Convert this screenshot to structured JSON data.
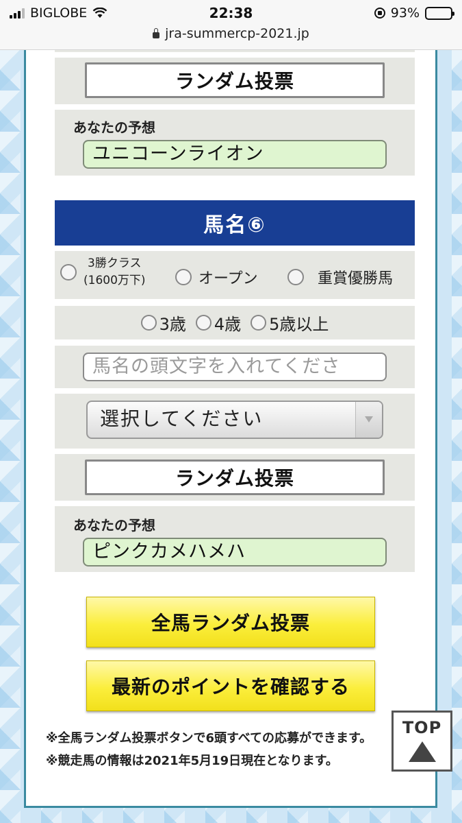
{
  "status_bar": {
    "carrier": "BIGLOBE",
    "time": "22:38",
    "battery": "93%",
    "battery_level": 0.93,
    "url": "jra-summercp-2021.jp"
  },
  "prev_entry": {
    "random_label": "ランダム投票",
    "guess_label": "あなたの予想",
    "guess_value": "ユニコーンライオン"
  },
  "horse6": {
    "title": "馬名⑥",
    "class_options": [
      {
        "line1": "3勝クラス",
        "line2": "(1600万下)"
      },
      {
        "label": "オープン"
      },
      {
        "label": "重賞優勝馬"
      }
    ],
    "age_options": [
      "3歳",
      "4歳",
      "5歳以上"
    ],
    "search_placeholder": "馬名の頭文字を入れてくださ",
    "select_value": "選択してください",
    "random_label": "ランダム投票",
    "guess_label": "あなたの予想",
    "guess_value": "ピンクカメハメハ"
  },
  "buttons": {
    "all_random": "全馬ランダム投票",
    "check_points": "最新のポイントを確認する"
  },
  "notes": [
    "※全馬ランダム投票ボタンで6頭すべての応募ができます。",
    "※競走馬の情報は2021年5月19日現在となります。"
  ],
  "top_button": "TOP",
  "colors": {
    "header_blue": "#183e94",
    "guess_green": "#dff5d0",
    "button_yellow": "#fbee3c"
  }
}
